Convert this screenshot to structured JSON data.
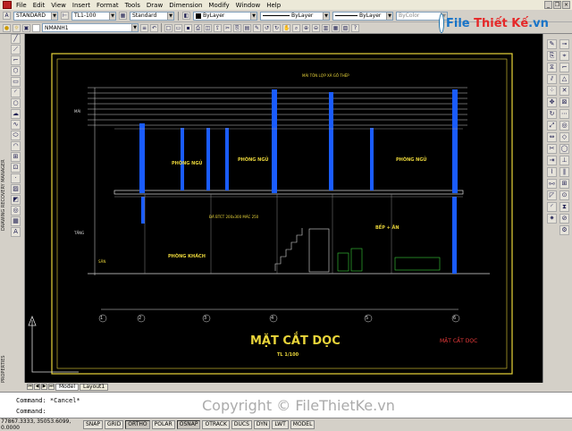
{
  "menu": [
    "File",
    "Edit",
    "View",
    "Insert",
    "Format",
    "Tools",
    "Draw",
    "Dimension",
    "Modify",
    "Window",
    "Help"
  ],
  "toolbar1": {
    "text_style": "STANDARD",
    "dim_style": "TL1-100",
    "table_style": "Standard",
    "color": "ByLayer",
    "linetype": "ByLayer",
    "lineweight": "ByLayer",
    "plotstyle": "ByColor"
  },
  "toolbar2": {
    "layer": "NMANH1"
  },
  "logo": {
    "part1": "File",
    "part2": "Thiết Kế",
    "part3": ".vn"
  },
  "palette_labels": {
    "left": "DRAWING RECOVERY MANAGER",
    "left2": "PROPERTIES"
  },
  "drawing": {
    "title": "MẶT CẮT DỌC",
    "scale": "TL 1/100",
    "side_title": "MẶT CẮT DỌC",
    "rooms": [
      "PHÒNG NGỦ",
      "PHÒNG NGỦ",
      "PHÒNG NGỦ",
      "PHÒNG KHÁCH",
      "BẾP + ĂN"
    ],
    "notes": [
      "MÁI TÔN LỢP XÀ GỒ THÉP",
      "ĐÀ BTCT 200x300 MÁC 250"
    ],
    "levels": [
      "+6600",
      "+3300",
      "±0.000"
    ],
    "axes": [
      "1",
      "2",
      "3",
      "4",
      "5",
      "6"
    ],
    "side_labels": [
      "MÁI",
      "TẦNG",
      "SÂN"
    ]
  },
  "tabs": [
    "Model",
    "Layout1"
  ],
  "command": {
    "line1": "Command: *Cancel*",
    "line2": "Command:"
  },
  "status": {
    "coords": "77867.3333, 35053.6099, 0.0000",
    "toggles": [
      "SNAP",
      "GRID",
      "ORTHO",
      "POLAR",
      "OSNAP",
      "OTRACK",
      "DUCS",
      "DYN",
      "LWT",
      "MODEL"
    ]
  },
  "watermark": "Copyright © FileThietKe.vn",
  "colors": {
    "background": "#000000",
    "frame": "#e8d43a",
    "walls": "#1a5cff",
    "text": "#e8d43a",
    "green": "#3ad13a"
  }
}
